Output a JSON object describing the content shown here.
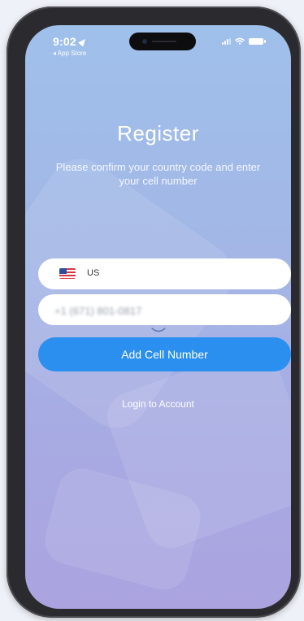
{
  "status_bar": {
    "time": "9:02",
    "back_app": "◂ App Store",
    "icons": [
      "location-arrow-icon",
      "signal-icon",
      "wifi-icon",
      "battery-icon"
    ]
  },
  "register": {
    "title": "Register",
    "subtitle": "Please confirm your country code and enter your cell number"
  },
  "form": {
    "country_code": "US",
    "country_flag_icon": "us-flag-icon",
    "phone_value": "+1 (671) 801-0817",
    "add_button_label": "Add Cell Number",
    "login_link_label": "Login to Account"
  },
  "colors": {
    "accent": "#2b8ff0",
    "background_top": "#9fc0ea",
    "background_bottom": "#aaa3df"
  }
}
